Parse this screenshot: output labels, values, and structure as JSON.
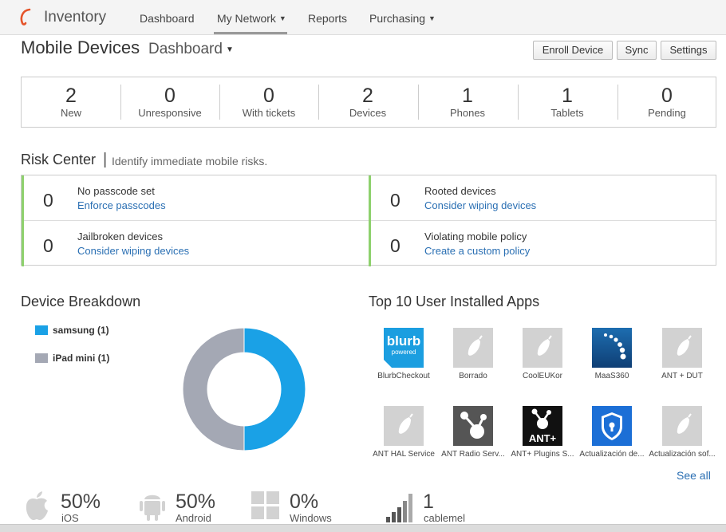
{
  "nav": {
    "brand": "Inventory",
    "items": [
      {
        "label": "Dashboard",
        "has_caret": false
      },
      {
        "label": "My Network",
        "has_caret": true,
        "active": true
      },
      {
        "label": "Reports",
        "has_caret": false
      },
      {
        "label": "Purchasing",
        "has_caret": true
      }
    ]
  },
  "header": {
    "title": "Mobile Devices",
    "subtitle": "Dashboard",
    "buttons": [
      "Enroll Device",
      "Sync",
      "Settings"
    ]
  },
  "stats": [
    {
      "value": "2",
      "label": "New"
    },
    {
      "value": "0",
      "label": "Unresponsive"
    },
    {
      "value": "0",
      "label": "With tickets"
    },
    {
      "value": "2",
      "label": "Devices"
    },
    {
      "value": "1",
      "label": "Phones"
    },
    {
      "value": "1",
      "label": "Tablets"
    },
    {
      "value": "0",
      "label": "Pending"
    }
  ],
  "risk_center": {
    "title": "Risk Center",
    "separator": "|",
    "subtitle": "Identify immediate mobile risks.",
    "items": [
      {
        "count": "0",
        "label": "No passcode set",
        "link": "Enforce passcodes"
      },
      {
        "count": "0",
        "label": "Rooted devices",
        "link": "Consider wiping devices"
      },
      {
        "count": "0",
        "label": "Jailbroken devices",
        "link": "Consider wiping devices"
      },
      {
        "count": "0",
        "label": "Violating mobile policy",
        "link": "Create a custom policy"
      }
    ]
  },
  "device_breakdown": {
    "title": "Device Breakdown",
    "legend": [
      {
        "label": "samsung (1)",
        "color": "#1aa1e6"
      },
      {
        "label": "iPad mini (1)",
        "color": "#a4a8b4"
      }
    ]
  },
  "chart_data": {
    "type": "pie",
    "categories": [
      "samsung",
      "iPad mini"
    ],
    "values": [
      1,
      1
    ],
    "colors": [
      "#1aa1e6",
      "#a4a8b4"
    ],
    "donut": true
  },
  "top_apps": {
    "title": "Top 10 User Installed Apps",
    "apps": [
      {
        "name": "BlurbCheckout",
        "icon": "blurb-icon",
        "icon_text": "blurb",
        "icon_sub": "powered"
      },
      {
        "name": "Borrado",
        "icon": "placeholder-app-icon"
      },
      {
        "name": "CoolEUKor",
        "icon": "placeholder-app-icon"
      },
      {
        "name": "MaaS360",
        "icon": "maas360-icon"
      },
      {
        "name": "ANT + DUT",
        "icon": "placeholder-app-icon"
      },
      {
        "name": "ANT HAL Service",
        "icon": "placeholder-app-icon"
      },
      {
        "name": "ANT Radio Serv...",
        "icon": "ant-radio-icon"
      },
      {
        "name": "ANT+ Plugins S...",
        "icon": "ant-plus-icon",
        "icon_text": "ANT+"
      },
      {
        "name": "Actualización de...",
        "icon": "shield-lock-icon"
      },
      {
        "name": "Actualización sof...",
        "icon": "placeholder-app-icon"
      }
    ],
    "see_all": "See all"
  },
  "os_breakdown": [
    {
      "icon": "apple-icon",
      "percent": "50%",
      "label": "iOS"
    },
    {
      "icon": "android-icon",
      "percent": "50%",
      "label": "Android"
    },
    {
      "icon": "windows-icon",
      "percent": "0%",
      "label": "Windows"
    },
    {
      "icon": "signal-bars-icon",
      "percent": "1",
      "label": "cablemel"
    }
  ]
}
